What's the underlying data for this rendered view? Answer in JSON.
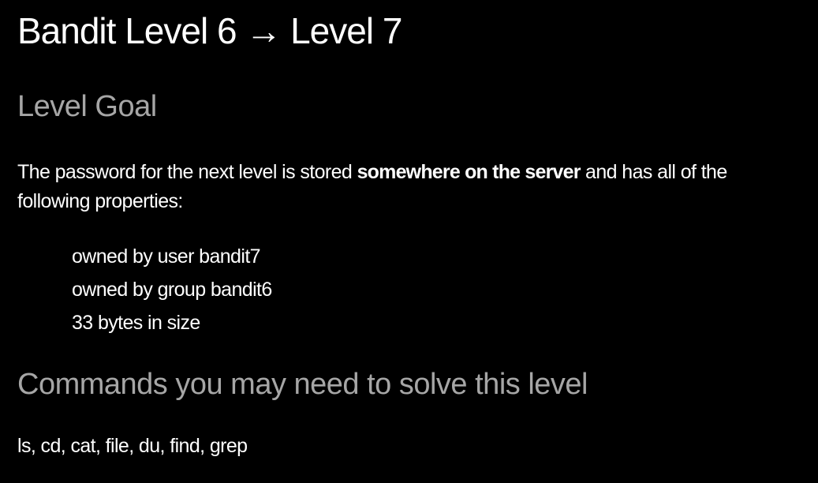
{
  "title": "Bandit Level 6 → Level 7",
  "level_goal": {
    "heading": "Level Goal",
    "text_before": "The password for the next level is stored ",
    "text_bold": "somewhere on the server",
    "text_after": " and has all of the following properties:",
    "properties": [
      "owned by user bandit7",
      "owned by group bandit6",
      "33 bytes in size"
    ]
  },
  "commands": {
    "heading": "Commands you may need to solve this level",
    "list": "ls, cd, cat, file, du, find, grep"
  }
}
